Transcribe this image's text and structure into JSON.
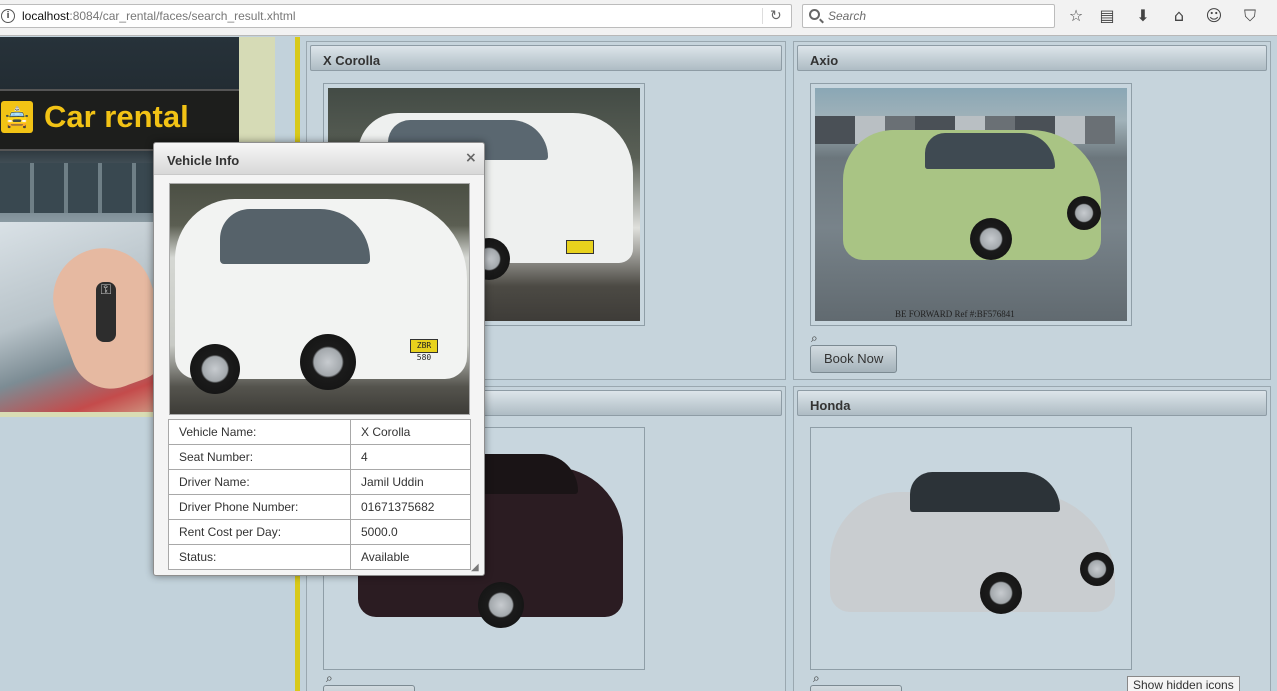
{
  "browser": {
    "url_host": "localhost",
    "url_path": ":8084/car_rental/faces/search_result.xhtml",
    "search_placeholder": "Search",
    "icons": [
      "info-icon",
      "reload-icon",
      "search-icon",
      "bookmark-star-icon",
      "reading-list-icon",
      "downloads-icon",
      "home-icon",
      "chat-icon",
      "pocket-icon"
    ]
  },
  "banner": {
    "sign_text": "Car rental"
  },
  "vehicles": [
    {
      "name": "X Corolla",
      "book_label": ""
    },
    {
      "name": "Axio",
      "book_label": "Book Now",
      "image_ref": "BE FORWARD Ref #:BF576841"
    },
    {
      "name": "",
      "book_label": ""
    },
    {
      "name": "Honda",
      "book_label": ""
    }
  ],
  "dialog": {
    "title": "Vehicle Info",
    "plate": "ZBR 580",
    "rows": [
      {
        "label": "Vehicle Name:",
        "value": "X Corolla"
      },
      {
        "label": "Seat Number:",
        "value": "4"
      },
      {
        "label": "Driver Name:",
        "value": "Jamil Uddin"
      },
      {
        "label": "Driver Phone Number:",
        "value": "01671375682"
      },
      {
        "label": "Rent Cost per Day:",
        "value": "5000.0"
      },
      {
        "label": "Status:",
        "value": "Available"
      }
    ]
  },
  "tooltip": "Show hidden icons",
  "colors": {
    "page_bg": "#c2d2db",
    "divider": "#d8c91a",
    "sign_yellow": "#f2c315"
  }
}
